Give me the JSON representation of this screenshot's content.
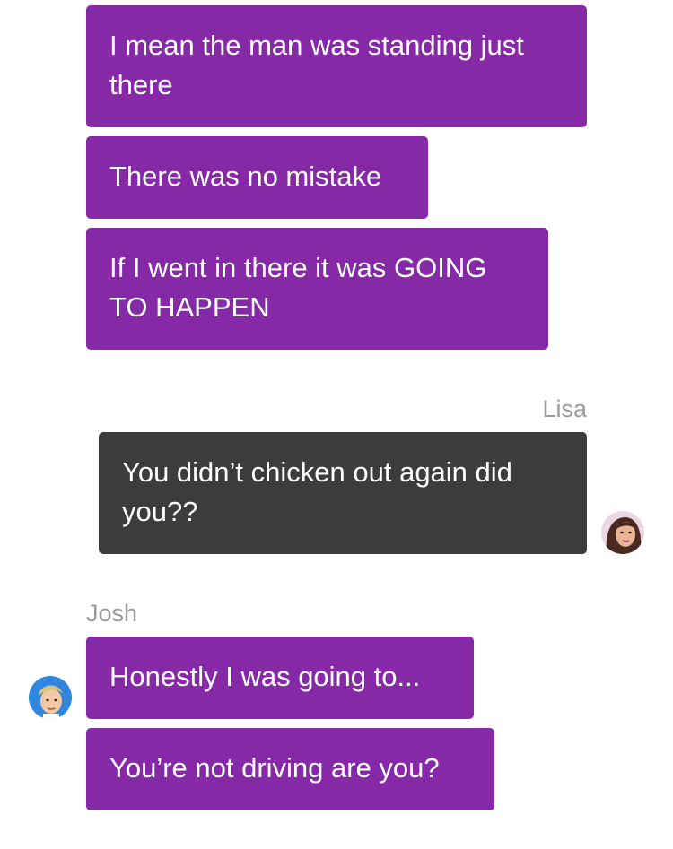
{
  "conversation": {
    "messages": [
      {
        "sender": "Josh",
        "text": "I mean the man was standing just there"
      },
      {
        "sender": "Josh",
        "text": "There was no mistake"
      },
      {
        "sender": "Josh",
        "text": "If I went in there it was GOING TO HAPPEN"
      },
      {
        "sender": "Lisa",
        "text": "You didn’t chicken out again did you??"
      },
      {
        "sender": "Josh",
        "text": "Honestly I was going to..."
      },
      {
        "sender": "Josh",
        "text": "You’re not driving are you?"
      }
    ],
    "sender_labels": {
      "lisa": "Lisa",
      "josh": "Josh"
    }
  },
  "avatars": {
    "lisa": {
      "icon": "lisa-avatar-icon",
      "description_color": "#5a3a2c"
    },
    "josh": {
      "icon": "josh-avatar-icon",
      "description_color": "#2e86de"
    }
  },
  "colors": {
    "outgoing_bubble": "#8629a6",
    "incoming_bubble": "#3c3c3c",
    "sender_label": "#9a9a9a"
  }
}
